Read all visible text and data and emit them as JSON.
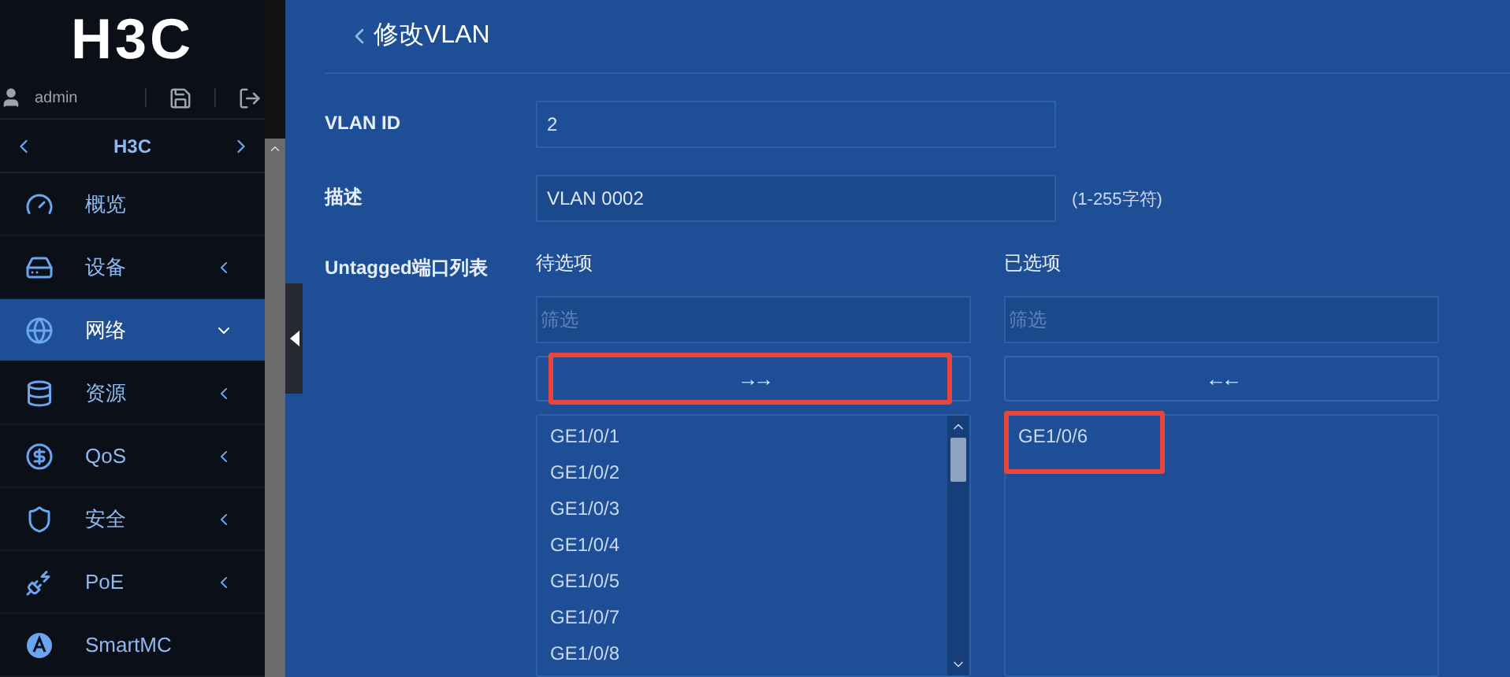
{
  "logo": "H3C",
  "user": {
    "name": "admin"
  },
  "sidebar": {
    "device": "H3C",
    "items": [
      {
        "label": "概览",
        "kind": "leaf",
        "selected": false
      },
      {
        "label": "设备",
        "kind": "group",
        "selected": false,
        "expanded": false
      },
      {
        "label": "网络",
        "kind": "group",
        "selected": true,
        "expanded": true
      },
      {
        "label": "资源",
        "kind": "group",
        "selected": false,
        "expanded": false
      },
      {
        "label": "QoS",
        "kind": "group",
        "selected": false,
        "expanded": false
      },
      {
        "label": "安全",
        "kind": "group",
        "selected": false,
        "expanded": false
      },
      {
        "label": "PoE",
        "kind": "group",
        "selected": false,
        "expanded": false
      },
      {
        "label": "SmartMC",
        "kind": "leaf",
        "selected": false
      }
    ]
  },
  "page": {
    "title": "修改VLAN",
    "fields": [
      {
        "label": "VLAN ID",
        "value": "2"
      },
      {
        "label": "描述",
        "value": "VLAN 0002",
        "hint": "(1-255字符)"
      }
    ],
    "port_list": {
      "label": "Untagged端口列表",
      "available": {
        "heading": "待选项",
        "filter": {
          "placeholder": "筛选"
        },
        "move_button": {
          "label": "→→",
          "highlighted": true
        },
        "items": [
          {
            "label": "GE1/0/1",
            "highlighted": false
          },
          {
            "label": "GE1/0/2",
            "highlighted": false
          },
          {
            "label": "GE1/0/3",
            "highlighted": false
          },
          {
            "label": "GE1/0/4",
            "highlighted": false
          },
          {
            "label": "GE1/0/5",
            "highlighted": false
          },
          {
            "label": "GE1/0/7",
            "highlighted": false
          },
          {
            "label": "GE1/0/8",
            "highlighted": false
          }
        ]
      },
      "chosen": {
        "heading": "已选项",
        "filter": {
          "placeholder": "筛选"
        },
        "move_button": {
          "label": "←←",
          "highlighted": false
        },
        "items": [
          {
            "label": "GE1/0/6",
            "highlighted": true
          }
        ]
      }
    }
  }
}
